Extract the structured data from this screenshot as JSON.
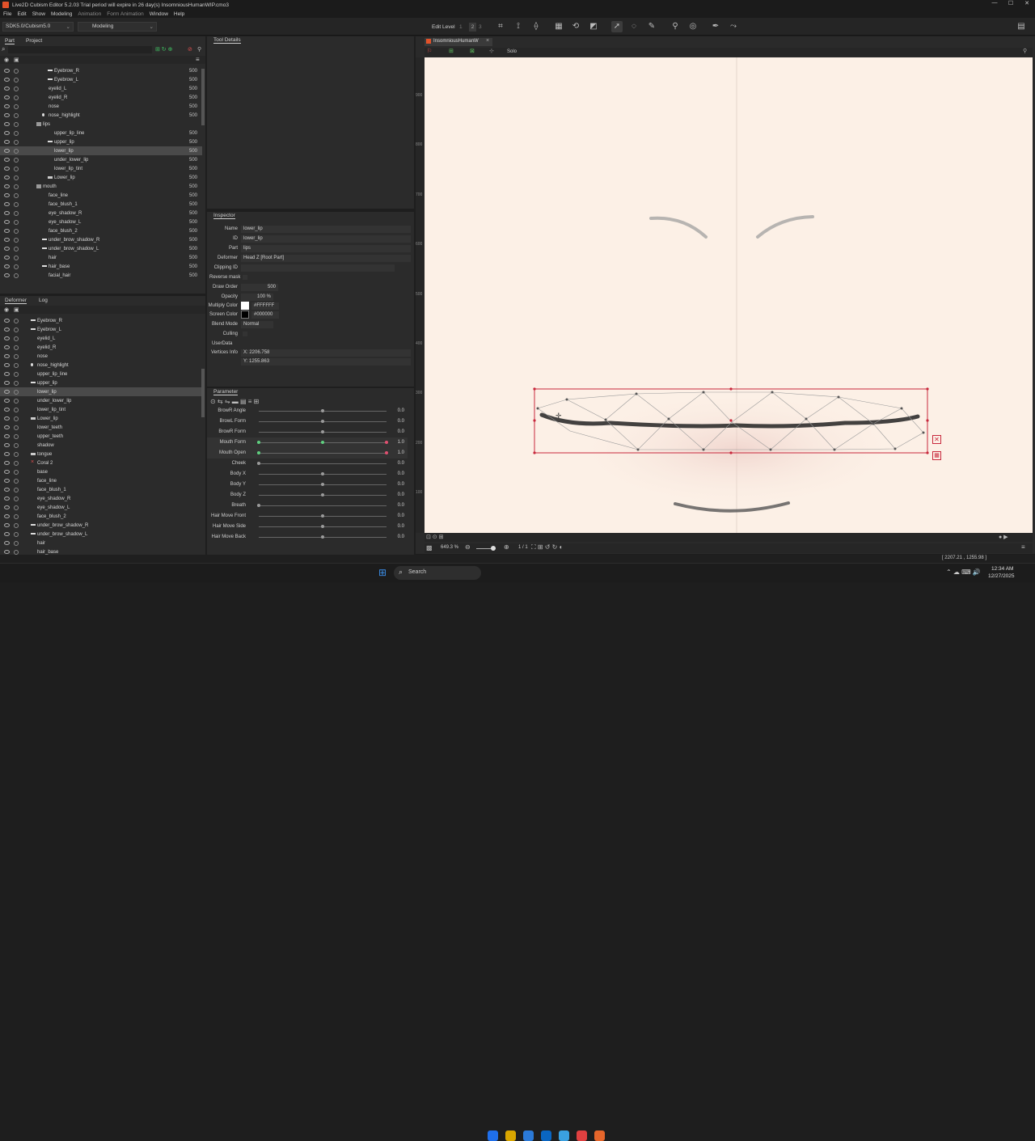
{
  "window": {
    "title": "Live2D Cubism Editor 5.2.03    Trial period will expire in 26 day(s)    InsomniousHumanWIP.cmo3",
    "controls": [
      "—",
      "☐",
      "✕"
    ]
  },
  "menu": [
    "File",
    "Edit",
    "Show",
    "Modeling",
    "Animation",
    "Form Animation",
    "Window",
    "Help"
  ],
  "toolbar": {
    "sdk_select": "SDK5.0/Cubism5.0",
    "mode_select": "Modeling",
    "edit_level_label": "Edit Level",
    "edit_levels": [
      "1",
      "2",
      "3"
    ]
  },
  "part_panel": {
    "tabs": [
      "Part",
      "Project"
    ],
    "rows": [
      {
        "label": "Eyebrow_R",
        "value": "500",
        "indent": 2,
        "mark": "line"
      },
      {
        "label": "Eyebrow_L",
        "value": "500",
        "indent": 2,
        "mark": "line"
      },
      {
        "label": "eyelid_L",
        "value": "500",
        "indent": 1
      },
      {
        "label": "eyelid_R",
        "value": "500",
        "indent": 1
      },
      {
        "label": "nose",
        "value": "500",
        "indent": 1
      },
      {
        "label": "nose_highlight",
        "value": "500",
        "indent": 1,
        "mark": "dot"
      },
      {
        "label": "lips",
        "value": "",
        "indent": 0,
        "mark": "folder"
      },
      {
        "label": "upper_lip_line",
        "value": "500",
        "indent": 2
      },
      {
        "label": "upper_lip",
        "value": "500",
        "indent": 2,
        "mark": "line"
      },
      {
        "label": "lower_lip",
        "value": "500",
        "indent": 2,
        "selected": true
      },
      {
        "label": "under_lower_lip",
        "value": "500",
        "indent": 2
      },
      {
        "label": "lower_lip_tint",
        "value": "500",
        "indent": 2
      },
      {
        "label": "Lower_lip",
        "value": "500",
        "indent": 2,
        "mark": "tri"
      },
      {
        "label": "mouth",
        "value": "500",
        "indent": 0,
        "mark": "folder"
      },
      {
        "label": "face_line",
        "value": "500",
        "indent": 1
      },
      {
        "label": "face_blush_1",
        "value": "500",
        "indent": 1
      },
      {
        "label": "eye_shadow_R",
        "value": "500",
        "indent": 1
      },
      {
        "label": "eye_shadow_L",
        "value": "500",
        "indent": 1
      },
      {
        "label": "face_blush_2",
        "value": "500",
        "indent": 1
      },
      {
        "label": "under_brow_shadow_R",
        "value": "500",
        "indent": 1,
        "mark": "line"
      },
      {
        "label": "under_brow_shadow_L",
        "value": "500",
        "indent": 1,
        "mark": "line"
      },
      {
        "label": "hair",
        "value": "500",
        "indent": 1
      },
      {
        "label": "hair_base",
        "value": "500",
        "indent": 1,
        "mark": "line"
      },
      {
        "label": "facial_hair",
        "value": "500",
        "indent": 1
      }
    ]
  },
  "deformer_panel": {
    "tabs": [
      "Deformer",
      "Log"
    ],
    "rows": [
      {
        "label": "Eyebrow_R",
        "mark": "line"
      },
      {
        "label": "Eyebrow_L",
        "mark": "line"
      },
      {
        "label": "eyelid_L"
      },
      {
        "label": "eyelid_R"
      },
      {
        "label": "nose"
      },
      {
        "label": "nose_highlight",
        "mark": "dot"
      },
      {
        "label": "upper_lip_line"
      },
      {
        "label": "upper_lip",
        "mark": "line"
      },
      {
        "label": "lower_lip",
        "selected": true
      },
      {
        "label": "under_lower_lip"
      },
      {
        "label": "lower_lip_tint"
      },
      {
        "label": "Lower_lip",
        "mark": "tri"
      },
      {
        "label": "lower_teeth"
      },
      {
        "label": "upper_teeth"
      },
      {
        "label": "shadow"
      },
      {
        "label": "tongue",
        "mark": "tri"
      },
      {
        "label": "Coral 2",
        "mark": "x"
      },
      {
        "label": "base"
      },
      {
        "label": "face_line"
      },
      {
        "label": "face_blush_1"
      },
      {
        "label": "eye_shadow_R"
      },
      {
        "label": "eye_shadow_L"
      },
      {
        "label": "face_blush_2"
      },
      {
        "label": "under_brow_shadow_R",
        "mark": "line"
      },
      {
        "label": "under_brow_shadow_L",
        "mark": "line"
      },
      {
        "label": "hair"
      },
      {
        "label": "hair_base"
      }
    ]
  },
  "tool_details": {
    "title": "Tool Details"
  },
  "inspector": {
    "title": "Inspector",
    "name_label": "Name",
    "name": "lower_lip",
    "id_label": "ID",
    "id": "lower_lip",
    "part_label": "Part",
    "part": "lips",
    "deformer_label": "Deformer",
    "deformer": "Head Z [Root Part]",
    "clipping_label": "Clipping ID",
    "clipping": "",
    "reverse_mask_label": "Reverse mask",
    "draw_order_label": "Draw Order",
    "draw_order": "500",
    "opacity_label": "Opacity",
    "opacity": "100 %",
    "multiply_label": "Multiply Color",
    "multiply": "#FFFFFF",
    "screen_label": "Screen Color",
    "screen": "#000000",
    "blend_label": "Blend Mode",
    "blend": "Normal",
    "culling_label": "Culling",
    "userdata_label": "UserData",
    "vertices_label": "Vertices Info",
    "vertices_x": "X: 2206.758",
    "vertices_y": "Y: 1255.863"
  },
  "parameters": {
    "title": "Parameter",
    "rows": [
      {
        "name": "BrowR Angle",
        "value": "0.0",
        "knob": 0.5,
        "mark": false
      },
      {
        "name": "BrowL Form",
        "value": "0.0",
        "knob": 0.5,
        "mark": false
      },
      {
        "name": "BrowR Form",
        "value": "0.0",
        "knob": 0.5,
        "mark": false
      },
      {
        "name": "Mouth Form",
        "value": "1.0",
        "knob": 1.0,
        "mark": true
      },
      {
        "name": "Mouth Open",
        "value": "1.0",
        "knob": 1.0,
        "mark": true
      },
      {
        "name": "Cheek",
        "value": "0.0",
        "knob": 0.0,
        "mark": false
      },
      {
        "name": "Body X",
        "value": "0.0",
        "knob": 0.5,
        "mark": false
      },
      {
        "name": "Body Y",
        "value": "0.0",
        "knob": 0.5,
        "mark": false
      },
      {
        "name": "Body Z",
        "value": "0.0",
        "knob": 0.5,
        "mark": false
      },
      {
        "name": "Breath",
        "value": "0.0",
        "knob": 0.0,
        "mark": false
      },
      {
        "name": "Hair Move Front",
        "value": "0.0",
        "knob": 0.5,
        "mark": false
      },
      {
        "name": "Hair Move Side",
        "value": "0.0",
        "knob": 0.5,
        "mark": false
      },
      {
        "name": "Hair Move Back",
        "value": "0.0",
        "knob": 0.5,
        "mark": false
      }
    ]
  },
  "viewport": {
    "tab": "InsomniousHumanW",
    "solo_label": "Solo",
    "ruler_labels": [
      "900",
      "800",
      "700",
      "600",
      "500",
      "400",
      "300",
      "200",
      "100"
    ],
    "zoom": "649.3 %",
    "page": "1 / 1"
  },
  "status": {
    "coords": "[ 2207.21 , 1255.98 ]"
  },
  "taskbar": {
    "search": "Search",
    "time": "12:34 AM",
    "date": "12/27/2025",
    "app_colors": [
      "#1f6feb",
      "#d9a600",
      "#2b7ad8",
      "#0a66c2",
      "#3aa0e0",
      "#e04040",
      "#e6662b"
    ]
  },
  "colors": {
    "accent_red": "#c8283c",
    "bg": "#2b2b2b",
    "canvas": "#fcf0e6"
  }
}
